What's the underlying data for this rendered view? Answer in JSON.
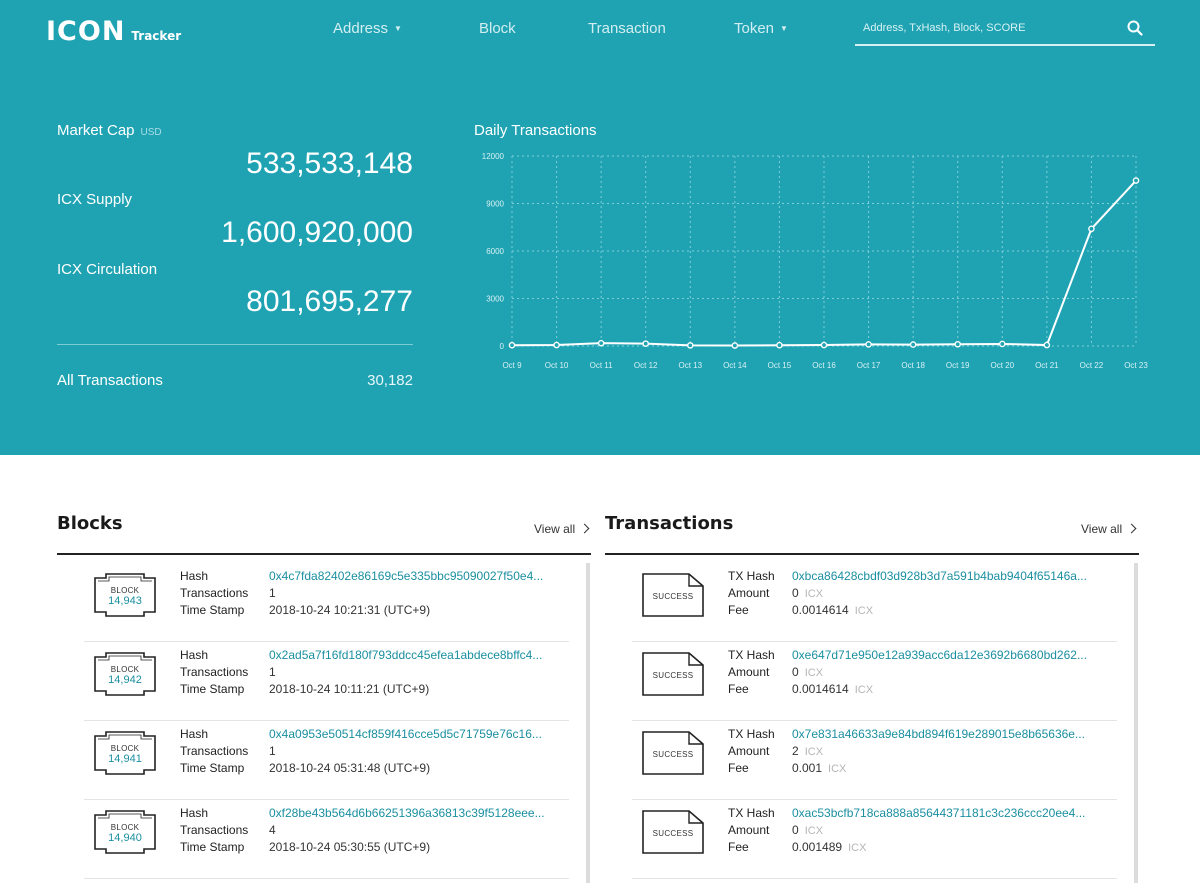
{
  "header": {
    "logo_text": "ICON",
    "logo_sub": "Tracker",
    "nav": [
      {
        "label": "Address",
        "dropdown": true
      },
      {
        "label": "Block",
        "dropdown": false
      },
      {
        "label": "Transaction",
        "dropdown": false
      },
      {
        "label": "Token",
        "dropdown": true
      }
    ],
    "search_placeholder": "Address, TxHash, Block, SCORE"
  },
  "stats": {
    "market_cap_label": "Market Cap",
    "market_cap_unit": "USD",
    "market_cap_value": "533,533,148",
    "supply_label": "ICX Supply",
    "supply_value": "1,600,920,000",
    "circulation_label": "ICX Circulation",
    "circulation_value": "801,695,277",
    "all_tx_label": "All Transactions",
    "all_tx_value": "30,182"
  },
  "chart_title": "Daily Transactions",
  "chart_data": {
    "type": "line",
    "x": [
      "Oct 9",
      "Oct 10",
      "Oct 11",
      "Oct 12",
      "Oct 13",
      "Oct 14",
      "Oct 15",
      "Oct 16",
      "Oct 17",
      "Oct 18",
      "Oct 19",
      "Oct 20",
      "Oct 21",
      "Oct 22",
      "Oct 23"
    ],
    "series": [
      {
        "values": [
          50,
          60,
          180,
          150,
          40,
          30,
          50,
          60,
          100,
          90,
          110,
          130,
          60,
          7400,
          10450
        ]
      }
    ],
    "yticks": [
      "0",
      "3000",
      "6000",
      "9000",
      "12000"
    ],
    "ylim": [
      0,
      12000
    ],
    "grid": true,
    "line_color": "#ffffff"
  },
  "colors": {
    "accent": "#1fa3b3",
    "link": "#1a8fa0"
  },
  "blocks": {
    "title": "Blocks",
    "view_all": "View all",
    "icon_label": "BLOCK",
    "keys": [
      "Hash",
      "Transactions",
      "Time Stamp"
    ],
    "items": [
      {
        "height": "14,943",
        "hash": "0x4c7fda82402e86169c5e335bbc95090027f50e4...",
        "tx_count": "1",
        "timestamp": "2018-10-24 10:21:31 (UTC+9)"
      },
      {
        "height": "14,942",
        "hash": "0x2ad5a7f16fd180f793ddcc45efea1abdece8bffc4...",
        "tx_count": "1",
        "timestamp": "2018-10-24 10:11:21 (UTC+9)"
      },
      {
        "height": "14,941",
        "hash": "0x4a0953e50514cf859f416cce5d5c71759e76c16...",
        "tx_count": "1",
        "timestamp": "2018-10-24 05:31:48 (UTC+9)"
      },
      {
        "height": "14,940",
        "hash": "0xf28be43b564d6b66251396a36813c39f5128eee...",
        "tx_count": "4",
        "timestamp": "2018-10-24 05:30:55 (UTC+9)"
      }
    ]
  },
  "transactions": {
    "title": "Transactions",
    "view_all": "View all",
    "icon_label": "SUCCESS",
    "keys": [
      "TX Hash",
      "Amount",
      "Fee"
    ],
    "unit": "ICX",
    "items": [
      {
        "hash": "0xbca86428cbdf03d928b3d7a591b4bab9404f65146a...",
        "amount": "0",
        "fee": "0.0014614"
      },
      {
        "hash": "0xe647d71e950e12a939acc6da12e3692b6680bd262...",
        "amount": "0",
        "fee": "0.0014614"
      },
      {
        "hash": "0x7e831a46633a9e84bd894f619e289015e8b65636e...",
        "amount": "2",
        "fee": "0.001"
      },
      {
        "hash": "0xac53bcfb718ca888a85644371181c3c236ccc20ee4...",
        "amount": "0",
        "fee": "0.001489"
      }
    ]
  }
}
